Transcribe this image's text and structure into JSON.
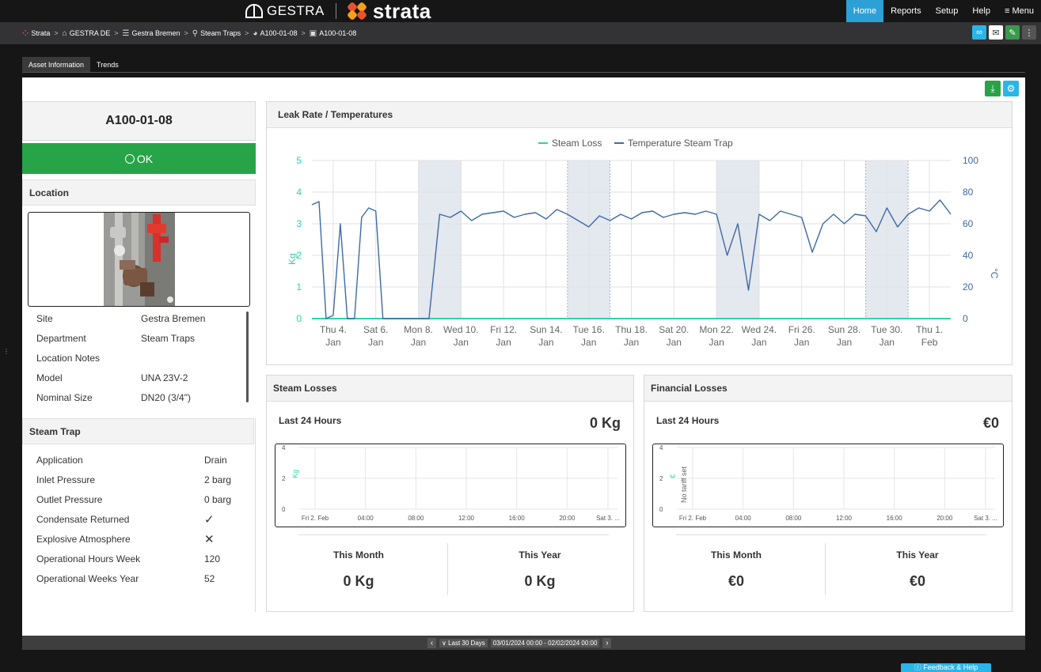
{
  "header": {
    "brand_gestra": "GESTRA",
    "brand_strata": "strata",
    "nav": [
      "Home",
      "Reports",
      "Setup",
      "Help",
      "≡ Menu"
    ]
  },
  "breadcrumb": [
    "Strata",
    "GESTRA DE",
    "Gestra Bremen",
    "Steam Traps",
    "A100-01-08",
    "A100-01-08"
  ],
  "tabs": [
    "Asset Information",
    "Trends"
  ],
  "asset": {
    "name": "A100-01-08",
    "status": "OK"
  },
  "location": {
    "heading": "Location",
    "rows": [
      {
        "k": "Site",
        "v": "Gestra Bremen"
      },
      {
        "k": "Department",
        "v": "Steam Traps"
      },
      {
        "k": "Location Notes",
        "v": ""
      },
      {
        "k": "Model",
        "v": "UNA 23V-2"
      },
      {
        "k": "Nominal Size",
        "v": "DN20 (3/4\")"
      }
    ]
  },
  "steam_trap": {
    "heading": "Steam Trap",
    "rows": [
      {
        "k": "Application",
        "v": "Drain"
      },
      {
        "k": "Inlet Pressure",
        "v": "2 barg"
      },
      {
        "k": "Outlet Pressure",
        "v": "0 barg"
      },
      {
        "k": "Condensate Returned",
        "v": "✓"
      },
      {
        "k": "Explosive Atmosphere",
        "v": "✕"
      },
      {
        "k": "Operational Hours Week",
        "v": "120"
      },
      {
        "k": "Operational Weeks Year",
        "v": "52"
      }
    ]
  },
  "main_chart": {
    "title": "Leak Rate / Temperatures",
    "legend": [
      "Steam Loss",
      "Temperature Steam Trap"
    ],
    "y_left_label": "Kg",
    "y_right_label": "°C",
    "y_left_ticks": [
      "0",
      "1",
      "2",
      "3",
      "4",
      "5"
    ],
    "y_right_ticks": [
      "0",
      "20",
      "40",
      "60",
      "80",
      "100"
    ],
    "x_ticks": [
      [
        "Thu 4.",
        "Jan"
      ],
      [
        "Sat 6.",
        "Jan"
      ],
      [
        "Mon 8.",
        "Jan"
      ],
      [
        "Wed 10.",
        "Jan"
      ],
      [
        "Fri 12.",
        "Jan"
      ],
      [
        "Sun 14.",
        "Jan"
      ],
      [
        "Tue 16.",
        "Jan"
      ],
      [
        "Thu 18.",
        "Jan"
      ],
      [
        "Sat 20.",
        "Jan"
      ],
      [
        "Mon 22.",
        "Jan"
      ],
      [
        "Wed 24.",
        "Jan"
      ],
      [
        "Fri 26.",
        "Jan"
      ],
      [
        "Sun 28.",
        "Jan"
      ],
      [
        "Tue 30.",
        "Jan"
      ],
      [
        "Thu 1.",
        "Feb"
      ]
    ],
    "colors": {
      "steam_loss": "#2bd4a8",
      "temperature": "#3d6aa5",
      "left_axis": "#2bd4a8",
      "right_axis": "#3d6aa5",
      "shade": "#e4e8ef"
    }
  },
  "chart_data": {
    "type": "line",
    "title": "Leak Rate / Temperatures",
    "x_range": [
      "2024-01-03",
      "2024-02-02"
    ],
    "xlabel": "",
    "ylabel": "Kg",
    "ylabel_right": "°C",
    "ylim": [
      0,
      5
    ],
    "ylim_right": [
      0,
      100
    ],
    "weekend_shading": [
      [
        "2024-01-08",
        "2024-01-10"
      ],
      [
        "2024-01-15",
        "2024-01-17"
      ],
      [
        "2024-01-22",
        "2024-01-24"
      ],
      [
        "2024-01-29",
        "2024-01-31"
      ]
    ],
    "grid": true,
    "legend": "top-center",
    "series": [
      {
        "name": "Steam Loss",
        "axis": "left",
        "x": [
          "2024-01-03",
          "2024-02-02"
        ],
        "values": [
          0,
          0
        ]
      },
      {
        "name": "Temperature Steam Trap",
        "axis": "right",
        "x": [
          "2024-01-03 00:00",
          "2024-01-03 08:00",
          "2024-01-03 16:00",
          "2024-01-04 00:00",
          "2024-01-04 08:00",
          "2024-01-04 16:00",
          "2024-01-05 00:00",
          "2024-01-05 08:00",
          "2024-01-05 16:00",
          "2024-01-06 00:00",
          "2024-01-06 08:00",
          "2024-01-06 16:00",
          "2024-01-07 00:00",
          "2024-01-07 08:00",
          "2024-01-07 16:00",
          "2024-01-08 00:00",
          "2024-01-08 12:00",
          "2024-01-09 00:00",
          "2024-01-09 12:00",
          "2024-01-10 00:00",
          "2024-01-10 12:00",
          "2024-01-11 00:00",
          "2024-01-11 12:00",
          "2024-01-12 00:00",
          "2024-01-12 12:00",
          "2024-01-13 00:00",
          "2024-01-13 12:00",
          "2024-01-14 00:00",
          "2024-01-14 12:00",
          "2024-01-15 00:00",
          "2024-01-15 12:00",
          "2024-01-16 00:00",
          "2024-01-16 12:00",
          "2024-01-17 00:00",
          "2024-01-17 12:00",
          "2024-01-18 00:00",
          "2024-01-18 12:00",
          "2024-01-19 00:00",
          "2024-01-19 12:00",
          "2024-01-20 00:00",
          "2024-01-20 12:00",
          "2024-01-21 00:00",
          "2024-01-21 12:00",
          "2024-01-22 00:00",
          "2024-01-22 12:00",
          "2024-01-23 00:00",
          "2024-01-23 12:00",
          "2024-01-24 00:00",
          "2024-01-24 12:00",
          "2024-01-25 00:00",
          "2024-01-25 12:00",
          "2024-01-26 00:00",
          "2024-01-26 12:00",
          "2024-01-27 00:00",
          "2024-01-27 12:00",
          "2024-01-28 00:00",
          "2024-01-28 12:00",
          "2024-01-29 00:00",
          "2024-01-29 12:00",
          "2024-01-30 00:00",
          "2024-01-30 12:00",
          "2024-01-31 00:00",
          "2024-01-31 12:00",
          "2024-02-01 00:00",
          "2024-02-01 12:00",
          "2024-02-02 00:00"
        ],
        "values": [
          72,
          74,
          0,
          2,
          60,
          0,
          0,
          64,
          70,
          68,
          0,
          0,
          0,
          0,
          0,
          0,
          0,
          66,
          64,
          68,
          62,
          66,
          67,
          68,
          64,
          66,
          67,
          63,
          69,
          66,
          62,
          58,
          65,
          62,
          66,
          63,
          67,
          68,
          64,
          66,
          67,
          66,
          68,
          66,
          40,
          60,
          18,
          66,
          62,
          68,
          66,
          64,
          42,
          60,
          66,
          60,
          66,
          65,
          55,
          70,
          58,
          66,
          70,
          68,
          75,
          66
        ]
      }
    ]
  },
  "steam_losses": {
    "heading": "Steam Losses",
    "last24_label": "Last 24 Hours",
    "last24_value": "0 Kg",
    "mini_ylabel": "Kg",
    "mini_yticks": [
      "0",
      "2",
      "4"
    ],
    "mini_xticks": [
      "Fri 2. Feb",
      "04:00",
      "08:00",
      "12:00",
      "16:00",
      "20:00",
      "Sat 3. ..."
    ],
    "this_month_label": "This Month",
    "this_month_value": "0 Kg",
    "this_year_label": "This Year",
    "this_year_value": "0 Kg"
  },
  "financial_losses": {
    "heading": "Financial Losses",
    "last24_label": "Last 24 Hours",
    "last24_value": "€0",
    "mini_ylabel": "€",
    "mini_note": "No tariff set",
    "mini_yticks": [
      "0",
      "2",
      "4"
    ],
    "mini_xticks": [
      "Fri 2. Feb",
      "04:00",
      "08:00",
      "12:00",
      "16:00",
      "20:00",
      "Sat 3. ..."
    ],
    "this_month_label": "This Month",
    "this_month_value": "€0",
    "this_year_label": "This Year",
    "this_year_value": "€0"
  },
  "date_range": {
    "preset": "Last 30 Days",
    "range": "03/01/2024 00:00 - 02/02/2024 00:00"
  },
  "feedback_label": "ⓘ Feedback & Help"
}
